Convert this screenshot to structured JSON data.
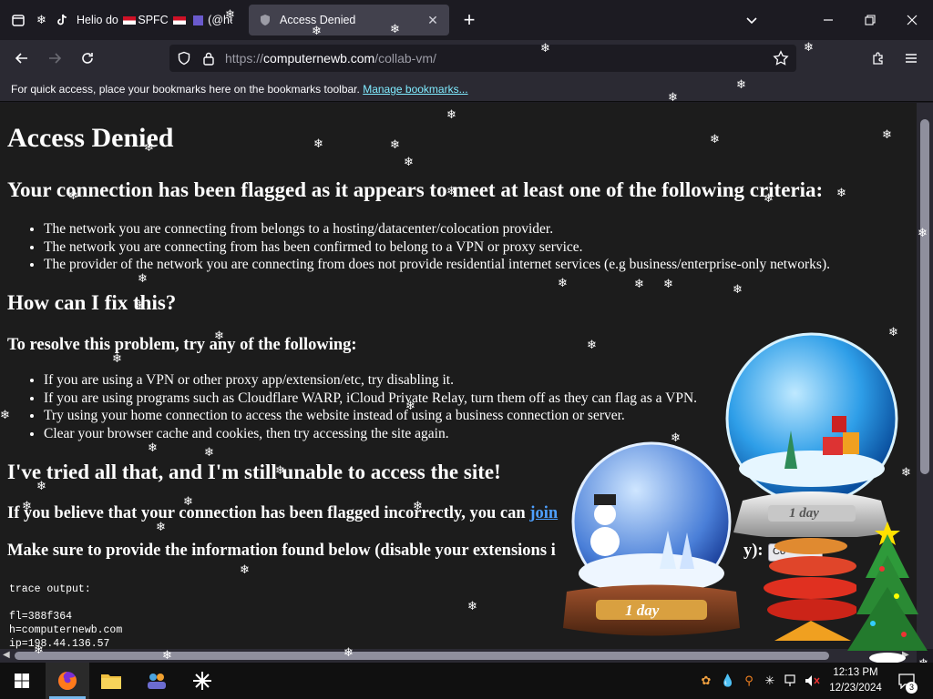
{
  "tabs": [
    {
      "label": "Helio do",
      "label_rest": "SPFC",
      "label_tail": "(@helio",
      "active": false
    },
    {
      "label": "Access Denied",
      "active": true
    }
  ],
  "nav": {
    "url_prefix": "https://",
    "url_host": "computernewb.com",
    "url_path": "/collab-vm/"
  },
  "bookmarks": {
    "message": "For quick access, place your bookmarks here on the bookmarks toolbar.",
    "manage_link": "Manage bookmarks..."
  },
  "page": {
    "title": "Access Denied",
    "flagged_heading": "Your connection has been flagged as it appears to meet at least one of the following criteria:",
    "criteria": [
      "The network you are connecting from belongs to a hosting/datacenter/colocation provider.",
      "The network you are connecting from has been confirmed to belong to a VPN or proxy service.",
      "The provider of the network you are connecting from does not provide residential internet services (e.g business/enterprise-only networks)."
    ],
    "fix_heading": "How can I fix this?",
    "resolve_heading": "To resolve this problem, try any of the following:",
    "fixes": [
      "If you are using a VPN or other proxy app/extension/etc, try disabling it.",
      "If you are using programs such as Cloudflare WARP, iCloud Private Relay, turn them off as they can flag as a VPN.",
      "Try using your home connection to access the website instead of using a business connection or server.",
      "Clear your browser cache and cookies, then try accessing the site again."
    ],
    "tried_heading": "I've tried all that, and I'm still unable to access the site!",
    "incorrect_text": "If you believe that your connection has been flagged incorrectly, you can",
    "join_link": "join",
    "provide_text": "Make sure to provide the information found below (disable your extensions i",
    "provide_tail": "y):",
    "copy_button": "Co",
    "trace_label": "trace output:",
    "trace_lines": [
      "fl=388f364",
      "h=computernewb.com",
      "ip=198.44.136.57"
    ]
  },
  "globes": {
    "left_label": "1 day",
    "right_label": "1 day"
  },
  "taskbar": {
    "time": "12:13 PM",
    "date": "12/23/2024",
    "notifications": "3"
  },
  "colors": {
    "accent": "#80ebff",
    "tab_active": "#42414d",
    "toolbar": "#2b2a33"
  }
}
